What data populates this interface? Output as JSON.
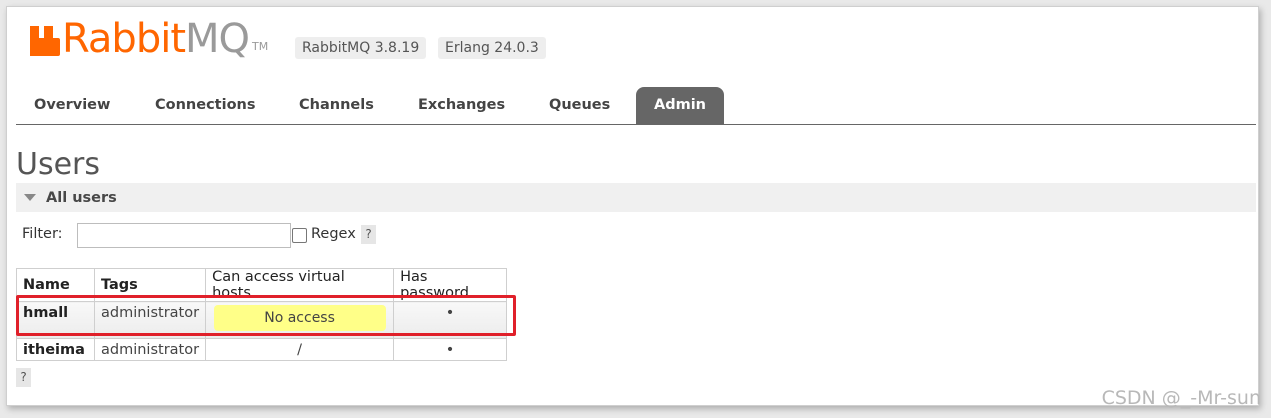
{
  "header": {
    "logo_rabbit": "Rabbit",
    "logo_mq": "MQ",
    "logo_tm": "TM",
    "version": "RabbitMQ 3.8.19",
    "erlang": "Erlang 24.0.3"
  },
  "tabs": [
    {
      "label": "Overview"
    },
    {
      "label": "Connections"
    },
    {
      "label": "Channels"
    },
    {
      "label": "Exchanges"
    },
    {
      "label": "Queues"
    },
    {
      "label": "Admin",
      "active": true
    }
  ],
  "page": {
    "title": "Users",
    "section_label": "All users"
  },
  "filter": {
    "label": "Filter:",
    "value": "",
    "placeholder": "",
    "regex_label": "Regex",
    "regex_checked": false,
    "help": "?"
  },
  "table": {
    "columns": [
      "Name",
      "Tags",
      "Can access virtual hosts",
      "Has password"
    ],
    "rows": [
      {
        "name": "hmall",
        "tags": "administrator",
        "vhosts": "No access",
        "has_password": "•"
      },
      {
        "name": "itheima",
        "tags": "administrator",
        "vhosts": "/",
        "has_password": "•"
      }
    ],
    "help": "?"
  },
  "watermark": "CSDN @_-Mr-sun",
  "colors": {
    "brand_orange": "#ff6600",
    "tab_active_bg": "#666666",
    "no_access_bg": "#ffff88",
    "highlight_border": "#e0202a"
  }
}
